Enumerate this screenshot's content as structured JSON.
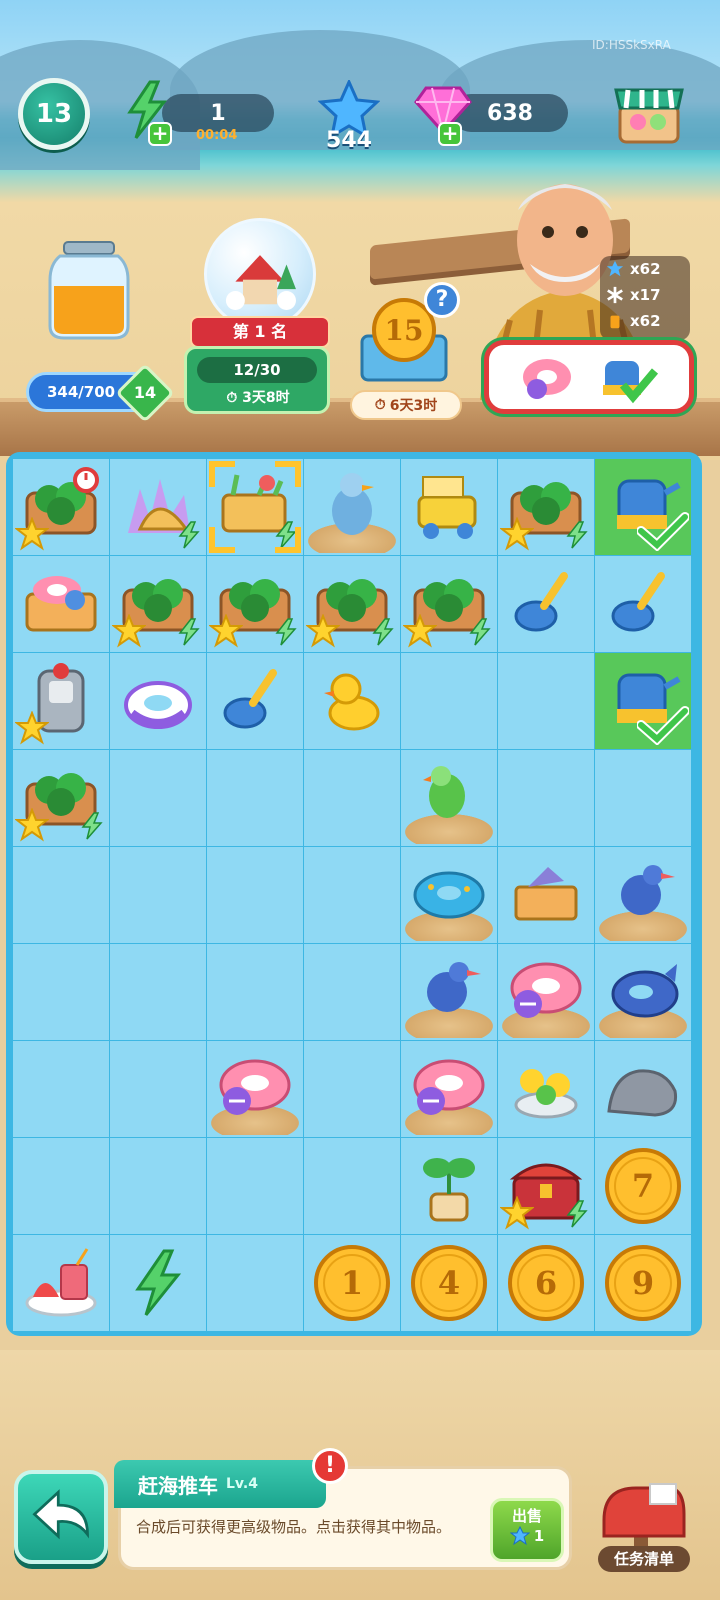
{
  "hud": {
    "level": "13",
    "energy": "1",
    "energy_timer": "00:04",
    "stars": "544",
    "gems": "638",
    "player_id": "ID:HSSkSxRA"
  },
  "jar": {
    "progress_text": "344/700",
    "progress_value": 344,
    "progress_max": 700,
    "level": "14"
  },
  "event": {
    "rank_label": "第 1 名",
    "progress_text": "12/30",
    "timer": "3天8时"
  },
  "coin_event": {
    "coin_value": "15",
    "help_icon": "?",
    "timer": "6天3时"
  },
  "resources": [
    {
      "icon": "blue-star-icon",
      "count": "x62"
    },
    {
      "icon": "snowflake-icon",
      "count": "x17"
    },
    {
      "icon": "juice-cup-icon",
      "count": "x62"
    }
  ],
  "board": {
    "rows": [
      [
        "watermelon-crate-timer",
        "coral-shell",
        "beach-cart-selected",
        "seagull-sand",
        "yellow-sand-truck",
        "watermelon-cart",
        "blue-watering-can-done"
      ],
      [
        "float-crate",
        "watermelon-cart",
        "watermelon-cart",
        "watermelon-cart",
        "watermelon-cart",
        "blue-shovel",
        "blue-shovel"
      ],
      [
        "juice-machine",
        "purple-float-ring",
        "blue-shovel",
        "rubber-duck",
        "empty",
        "empty",
        "blue-watering-can-done"
      ],
      [
        "watermelon-cart",
        "empty",
        "empty",
        "empty",
        "green-parrot-sand",
        "empty",
        "empty"
      ],
      [
        "empty",
        "empty",
        "empty",
        "empty",
        "donut-float-sand",
        "fish-crate",
        "blue-bird-sand"
      ],
      [
        "empty",
        "empty",
        "empty",
        "empty",
        "blue-bird-sand",
        "pink-float-ring-sand",
        "whale-float-sand"
      ],
      [
        "empty",
        "empty",
        "pink-float-ring-sand",
        "empty",
        "pink-float-ring-sand",
        "flower-pot-tray",
        "grey-rock"
      ],
      [
        "empty",
        "empty",
        "empty",
        "empty",
        "potted-plant",
        "treasure-chest",
        "coin-7"
      ],
      [
        "fruit-juice-plate",
        "energy-bolt",
        "empty",
        "coin-1",
        "coin-4",
        "coin-6",
        "coin-9"
      ]
    ],
    "coins": {
      "coin-1": "1",
      "coin-4": "4",
      "coin-6": "6",
      "coin-7": "7",
      "coin-9": "9"
    }
  },
  "selected_item": {
    "name": "赶海推车",
    "level": "Lv.4",
    "description": "合成后可获得更高级物品。点击获得其中物品。",
    "sell_label": "出售",
    "sell_price": "1"
  },
  "tasks": {
    "label": "任务清单"
  },
  "colors": {
    "board": "#3db7e3",
    "cell": "#8fd9f4",
    "done_cell": "#58c85a",
    "accent_teal": "#1ba58e",
    "alert_red": "#e53935"
  }
}
